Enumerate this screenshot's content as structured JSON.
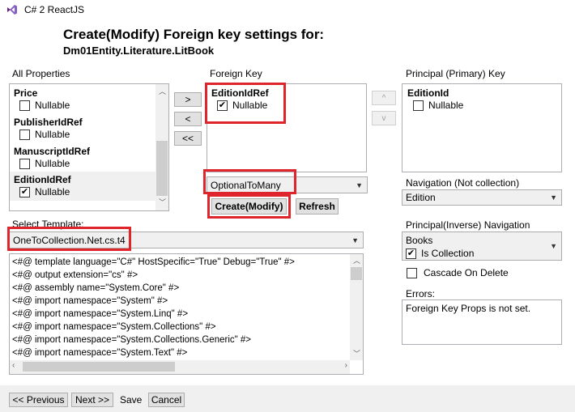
{
  "window": {
    "title": "C# 2 ReactJS"
  },
  "heading": {
    "title": "Create(Modify) Foreign key settings for:",
    "entity": "Dm01Entity.Literature.LitBook"
  },
  "all_properties": {
    "label": "All Properties",
    "items": [
      {
        "name": "Price",
        "nullable_label": "Nullable",
        "checked": false
      },
      {
        "name": "PublisherIdRef",
        "nullable_label": "Nullable",
        "checked": false
      },
      {
        "name": "ManuscriptIdRef",
        "nullable_label": "Nullable",
        "checked": false
      },
      {
        "name": "EditionIdRef",
        "nullable_label": "Nullable",
        "checked": true
      }
    ]
  },
  "move_buttons": {
    "add": ">",
    "remove": "<",
    "remove_all": "<<"
  },
  "foreign_key": {
    "label": "Foreign Key",
    "items": [
      {
        "name": "EditionIdRef",
        "nullable_label": "Nullable",
        "checked": true
      }
    ],
    "relation_value": "OptionalToMany",
    "create_label": "Create(Modify)",
    "refresh_label": "Refresh"
  },
  "order_buttons": {
    "up": "^",
    "down": "v"
  },
  "principal_key": {
    "label": "Principal (Primary) Key",
    "items": [
      {
        "name": "EditionId",
        "nullable_label": "Nullable",
        "checked": false
      }
    ]
  },
  "navigation": {
    "label": "Navigation (Not collection)",
    "value": "Edition"
  },
  "principal_inverse": {
    "label": "Principal(Inverse) Navigation",
    "value": "Books",
    "is_collection_label": "Is Collection",
    "is_collection_checked": true
  },
  "cascade": {
    "label": "Cascade On Delete",
    "checked": false
  },
  "errors": {
    "label": "Errors:",
    "text": "Foreign Key Props is not set."
  },
  "template": {
    "label": "Select Template:",
    "value": "OneToCollection.Net.cs.t4",
    "code_lines": [
      "<#@ template language=\"C#\" HostSpecific=\"True\" Debug=\"True\" #>",
      "<#@ output extension=\"cs\" #>",
      "<#@ assembly name=\"System.Core\" #>",
      "<#@ import namespace=\"System\" #>",
      "<#@ import namespace=\"System.Linq\" #>",
      "<#@ import namespace=\"System.Collections\" #>",
      "<#@ import namespace=\"System.Collections.Generic\" #>",
      "<#@ import namespace=\"System.Text\" #>"
    ]
  },
  "footer": {
    "previous": "<< Previous",
    "next": "Next >>",
    "save": "Save",
    "cancel": "Cancel"
  }
}
